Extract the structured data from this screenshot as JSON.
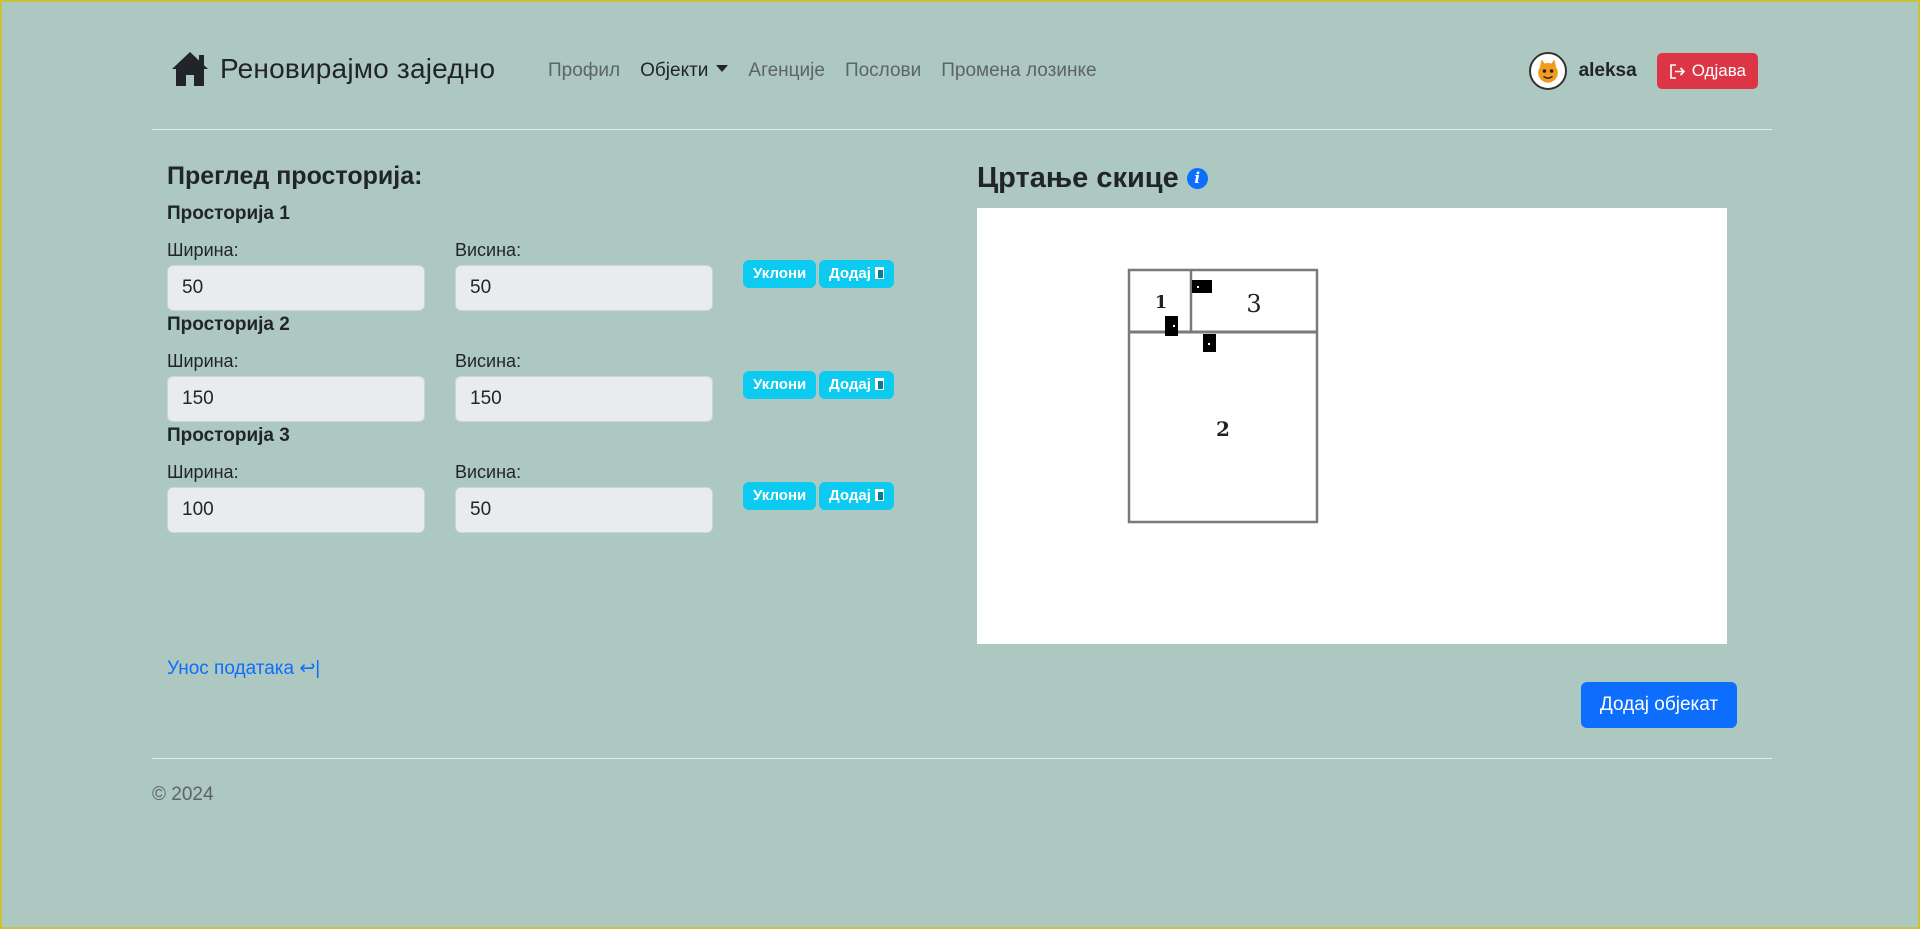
{
  "brand": {
    "title": "Реновирајмо заједно"
  },
  "nav": {
    "items": [
      "Профил",
      "Објекти",
      "Агенције",
      "Послови",
      "Промена лозинке"
    ]
  },
  "user": {
    "name": "aleksa",
    "logout_label": "Одјава"
  },
  "rooms_section": {
    "title": "Преглед просторија:",
    "width_label": "Ширина:",
    "height_label": "Висина:",
    "remove_label": "Уклони",
    "add_label": "Додај",
    "rooms": [
      {
        "title": "Просторија 1",
        "width": "50",
        "height": "50"
      },
      {
        "title": "Просторија 2",
        "width": "150",
        "height": "150"
      },
      {
        "title": "Просторија 3",
        "width": "100",
        "height": "50"
      }
    ]
  },
  "back_link": "Унос података ↩|",
  "sketch": {
    "title": "Цртање скице",
    "info_icon": "i",
    "labels": [
      "1",
      "2",
      "3"
    ]
  },
  "add_object_label": "Додај објекат",
  "footer": {
    "copyright": "© 2024"
  },
  "colors": {
    "background": "#adc8c0",
    "primary": "#0d6efd",
    "danger": "#dc3545",
    "info": "#0dcaf0"
  }
}
